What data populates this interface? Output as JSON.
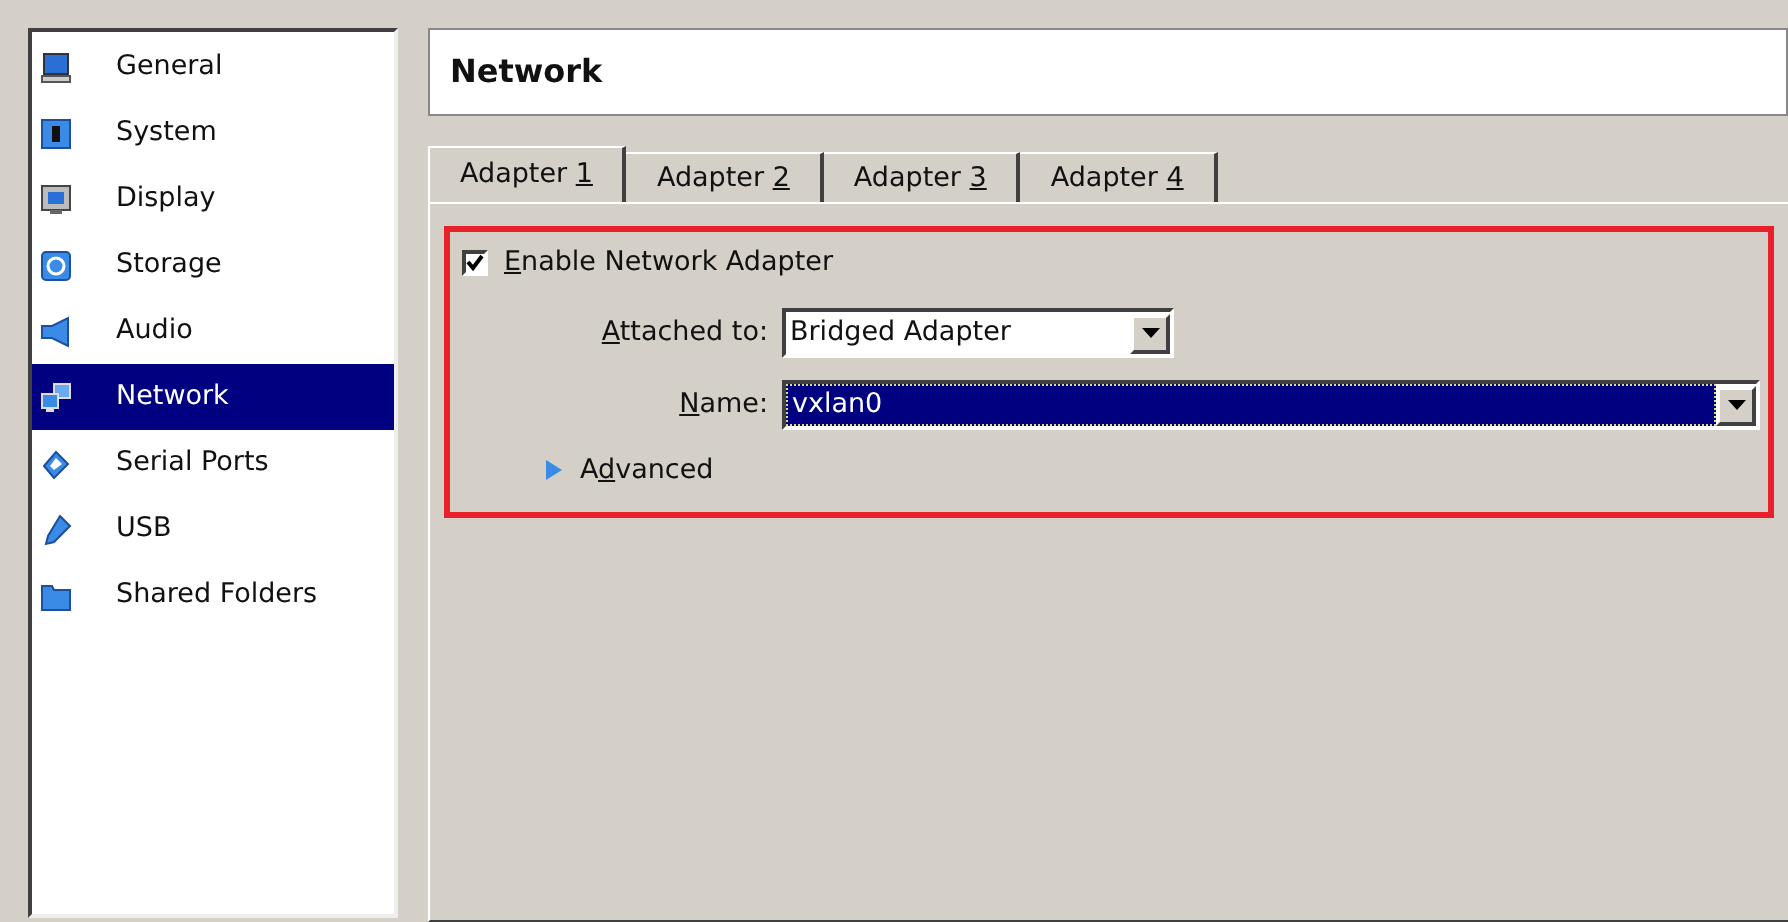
{
  "sidebar": {
    "items": [
      {
        "label": "General",
        "kind": "general",
        "selected": false
      },
      {
        "label": "System",
        "kind": "system",
        "selected": false
      },
      {
        "label": "Display",
        "kind": "display",
        "selected": false
      },
      {
        "label": "Storage",
        "kind": "storage",
        "selected": false
      },
      {
        "label": "Audio",
        "kind": "audio",
        "selected": false
      },
      {
        "label": "Network",
        "kind": "network",
        "selected": true
      },
      {
        "label": "Serial Ports",
        "kind": "serial",
        "selected": false
      },
      {
        "label": "USB",
        "kind": "usb",
        "selected": false
      },
      {
        "label": "Shared Folders",
        "kind": "folder",
        "selected": false
      }
    ]
  },
  "page_title": "Network",
  "tabs": [
    {
      "label": [
        {
          "text": "Adapter ",
          "underlined": false
        },
        {
          "text": "1",
          "underlined": true
        }
      ],
      "selected": true
    },
    {
      "label": [
        {
          "text": "Adapter ",
          "underlined": false
        },
        {
          "text": "2",
          "underlined": true
        }
      ],
      "selected": false
    },
    {
      "label": [
        {
          "text": "Adapter ",
          "underlined": false
        },
        {
          "text": "3",
          "underlined": true
        }
      ],
      "selected": false
    },
    {
      "label": [
        {
          "text": "Adapter ",
          "underlined": false
        },
        {
          "text": "4",
          "underlined": true
        }
      ],
      "selected": false
    }
  ],
  "enable_adapter": {
    "label": [
      {
        "text": "E",
        "underlined": true
      },
      {
        "text": "nable Network Adapter",
        "underlined": false
      }
    ],
    "checked": true
  },
  "attached_to": {
    "label": [
      {
        "text": "A",
        "underlined": true
      },
      {
        "text": "ttached to:",
        "underlined": false
      }
    ],
    "value": "Bridged Adapter"
  },
  "name": {
    "label": [
      {
        "text": "N",
        "underlined": true
      },
      {
        "text": "ame:",
        "underlined": false
      }
    ],
    "value": "vxlan0",
    "selected": true
  },
  "advanced": {
    "label": [
      {
        "text": "A",
        "underlined": false
      },
      {
        "text": "d",
        "underlined": true
      },
      {
        "text": "vanced",
        "underlined": false
      }
    ],
    "expanded": false
  }
}
